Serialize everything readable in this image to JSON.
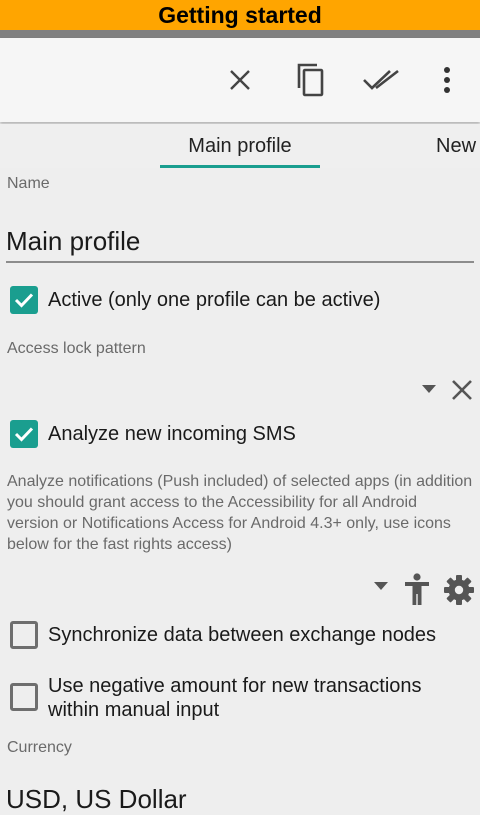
{
  "banner": {
    "title": "Getting started"
  },
  "toolbar": {
    "actions": [
      {
        "icon": "close-icon",
        "label": "Close"
      },
      {
        "icon": "copy-icon",
        "label": "Copy"
      },
      {
        "icon": "done-all-icon",
        "label": "Save"
      },
      {
        "icon": "more-vert-icon",
        "label": "More options"
      }
    ]
  },
  "tabs": [
    {
      "label": "Main profile",
      "selected": true
    },
    {
      "label": "New",
      "selected": false
    }
  ],
  "form": {
    "name_label": "Name",
    "name_value": "Main profile",
    "active_checkbox": {
      "label": "Active (only one profile can be active)",
      "checked": true
    },
    "access_lock_label": "Access lock pattern",
    "analyze_sms_checkbox": {
      "label": "Analyze new incoming SMS",
      "checked": true
    },
    "notifications_description": "Analyze notifications (Push included) of selected apps (in addition you should grant access to the Accessibility for all Android version or Notifications Access for Android 4.3+ only, use icons below for the fast rights access)",
    "sync_checkbox": {
      "label": "Synchronize data between exchange nodes",
      "checked": false
    },
    "negative_amount_checkbox": {
      "label": "Use negative amount for new transactions within manual input",
      "checked": false
    },
    "currency_label": "Currency",
    "currency_value": "USD, US Dollar"
  },
  "colors": {
    "banner": "#ffa500",
    "accent": "#1a9e8f",
    "background": "#eeeeee"
  }
}
